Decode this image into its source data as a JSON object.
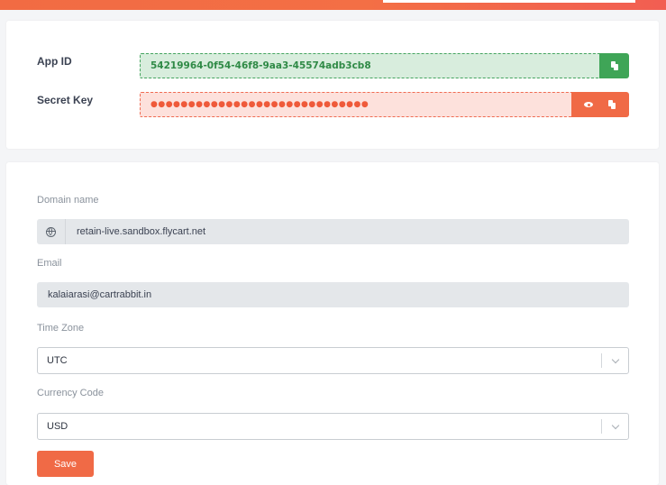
{
  "credentials": {
    "app_id_label": "App ID",
    "app_id_value": "54219964-0f54-46f8-9aa3-45574adb3cb8",
    "secret_key_label": "Secret Key",
    "secret_key_masked": "●●●●●●●●●●●●●●●●●●●●●●●●●●●●●",
    "icons": {
      "copy": "copy-icon",
      "show": "eye-icon"
    }
  },
  "settings": {
    "domain": {
      "label": "Domain name",
      "value": "retain-live.sandbox.flycart.net",
      "icon": "globe-icon"
    },
    "email": {
      "label": "Email",
      "value": "kalaiarasi@cartrabbit.in"
    },
    "timezone": {
      "label": "Time Zone",
      "selected": "UTC"
    },
    "currency": {
      "label": "Currency Code",
      "selected": "USD"
    },
    "save_label": "Save"
  },
  "colors": {
    "accent": "#f06a46",
    "success": "#3fa557",
    "success_bg": "#d8eddd",
    "danger_bg": "#fde1dc"
  }
}
